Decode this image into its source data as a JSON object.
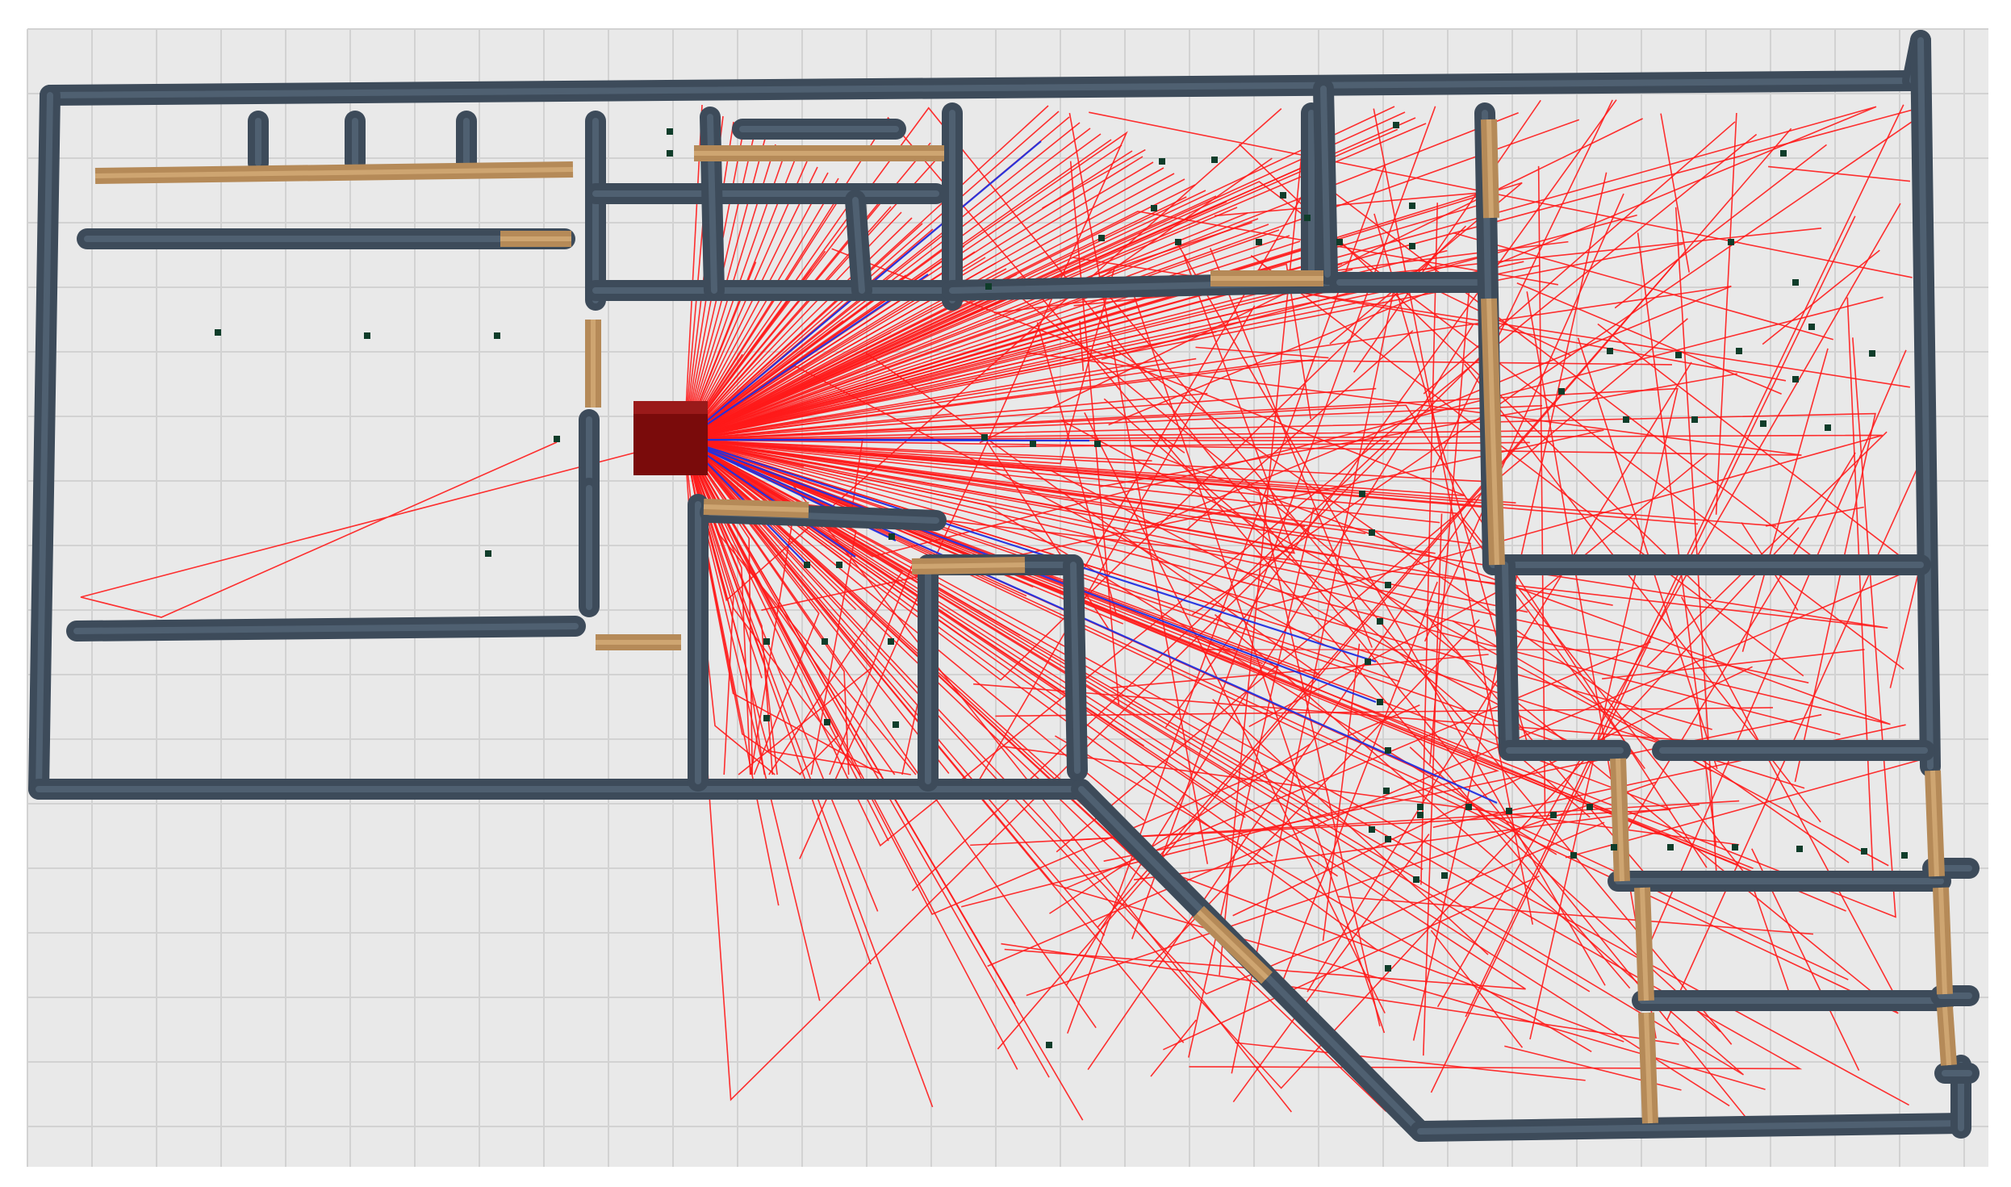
{
  "scene": {
    "description_visible_text": "",
    "background_color": "#ffffff",
    "floor_color": "#e9e9e9",
    "grid_color": "#d2d2d2",
    "wall_color": "#3d4b5a",
    "door_color": "#b58a58",
    "ray_reflected_color": "#ff1a1a",
    "ray_direct_color": "#2030e0",
    "transmitter_color": "#7a0b0b",
    "receiver_color": "#0f3d2a",
    "icons": [
      "transmitter-cube-icon",
      "receiver-point-icon"
    ]
  }
}
